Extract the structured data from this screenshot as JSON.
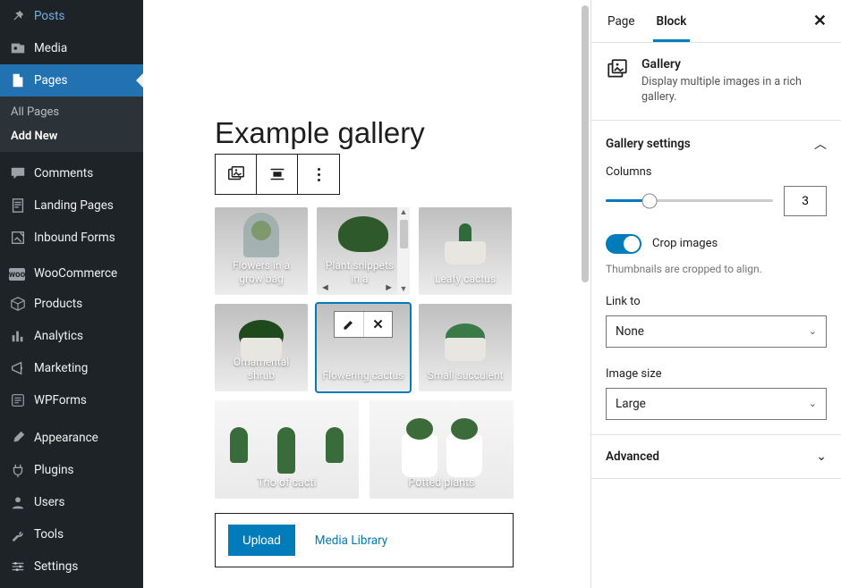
{
  "sidebar": {
    "items": [
      {
        "label": "Posts",
        "icon": "pin"
      },
      {
        "label": "Media",
        "icon": "media"
      },
      {
        "label": "Pages",
        "icon": "page",
        "active": true
      },
      {
        "label": "Comments",
        "icon": "comment"
      },
      {
        "label": "Landing Pages",
        "icon": "doc"
      },
      {
        "label": "Inbound Forms",
        "icon": "form"
      },
      {
        "label": "WooCommerce",
        "icon": "woo"
      },
      {
        "label": "Products",
        "icon": "box"
      },
      {
        "label": "Analytics",
        "icon": "bars"
      },
      {
        "label": "Marketing",
        "icon": "megaphone"
      },
      {
        "label": "WPForms",
        "icon": "wpforms"
      },
      {
        "label": "Appearance",
        "icon": "brush"
      },
      {
        "label": "Plugins",
        "icon": "plug"
      },
      {
        "label": "Users",
        "icon": "user"
      },
      {
        "label": "Tools",
        "icon": "wrench"
      },
      {
        "label": "Settings",
        "icon": "sliders"
      }
    ],
    "submenu": {
      "all_pages": "All Pages",
      "add_new": "Add New"
    }
  },
  "editor": {
    "title": "Example gallery",
    "toolbar": {
      "block_type": "Gallery block type",
      "align": "Change alignment",
      "more": "More options"
    },
    "gallery": [
      {
        "caption": "Flowers in a grow bag"
      },
      {
        "caption": "Plant snippets in a",
        "scroll": true
      },
      {
        "caption": "Leafy cactus"
      },
      {
        "caption": "Ornamental shrub"
      },
      {
        "caption": "Flowering cactus",
        "selected": true
      },
      {
        "caption": "Small succulent"
      }
    ],
    "gallery_wide": [
      {
        "caption": "Trio of cacti"
      },
      {
        "caption": "Potted plants"
      }
    ],
    "media": {
      "upload": "Upload",
      "library": "Media Library"
    }
  },
  "panel": {
    "tabs": {
      "page": "Page",
      "block": "Block"
    },
    "block": {
      "name": "Gallery",
      "desc": "Display multiple images in a rich gallery."
    },
    "gallery_settings": {
      "heading": "Gallery settings",
      "columns_label": "Columns",
      "columns_value": "3",
      "crop_label": "Crop images",
      "crop_help": "Thumbnails are cropped to align.",
      "link_label": "Link to",
      "link_value": "None",
      "size_label": "Image size",
      "size_value": "Large"
    },
    "advanced": "Advanced"
  }
}
